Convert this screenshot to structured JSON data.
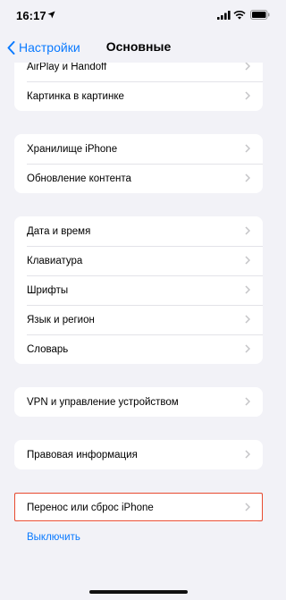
{
  "status_bar": {
    "time": "16:17"
  },
  "nav": {
    "back_label": "Настройки",
    "title": "Основные"
  },
  "groups": [
    {
      "items": [
        "AirPlay и Handoff",
        "Картинка в картинке"
      ]
    },
    {
      "items": [
        "Хранилище iPhone",
        "Обновление контента"
      ]
    },
    {
      "items": [
        "Дата и время",
        "Клавиатура",
        "Шрифты",
        "Язык и регион",
        "Словарь"
      ]
    },
    {
      "items": [
        "VPN и управление устройством"
      ]
    },
    {
      "items": [
        "Правовая информация"
      ]
    },
    {
      "items": [
        "Перенос или сброс iPhone"
      ]
    }
  ],
  "shutdown_label": "Выключить",
  "colors": {
    "accent": "#0a7aff",
    "highlight": "#e84a2f",
    "background": "#f2f2f7"
  },
  "icons": [
    "location-arrow-icon",
    "cellular-signal-icon",
    "wifi-icon",
    "battery-icon",
    "chevron-left-icon",
    "chevron-right-icon"
  ]
}
